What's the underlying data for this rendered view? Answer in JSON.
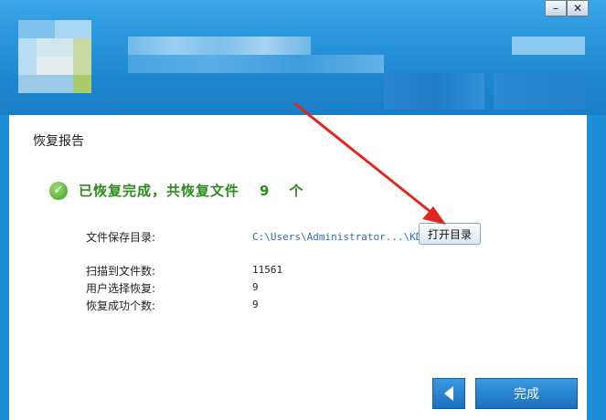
{
  "window": {
    "minimize_glyph": "–",
    "close_glyph": "✕"
  },
  "report": {
    "title": "恢复报告",
    "status_text": "已恢复完成，共恢复文件",
    "status_count": "9",
    "status_unit": "个",
    "save_dir_label": "文件保存目录:",
    "save_dir_value": "C:\\Users\\Administrator...\\KDR",
    "open_dir_button": "打开目录",
    "scanned_label": "扫描到文件数:",
    "scanned_value": "11561",
    "selected_label": "用户选择恢复:",
    "selected_value": "9",
    "success_label": "恢复成功个数:",
    "success_value": "9"
  },
  "footer": {
    "back_icon": "back-arrow-icon",
    "finish_button": "完成"
  },
  "colors": {
    "header_blue": "#1e8fd6",
    "success_green": "#2a8b1a",
    "path_blue": "#2a6cc2",
    "annotation_red": "#e2261f"
  }
}
